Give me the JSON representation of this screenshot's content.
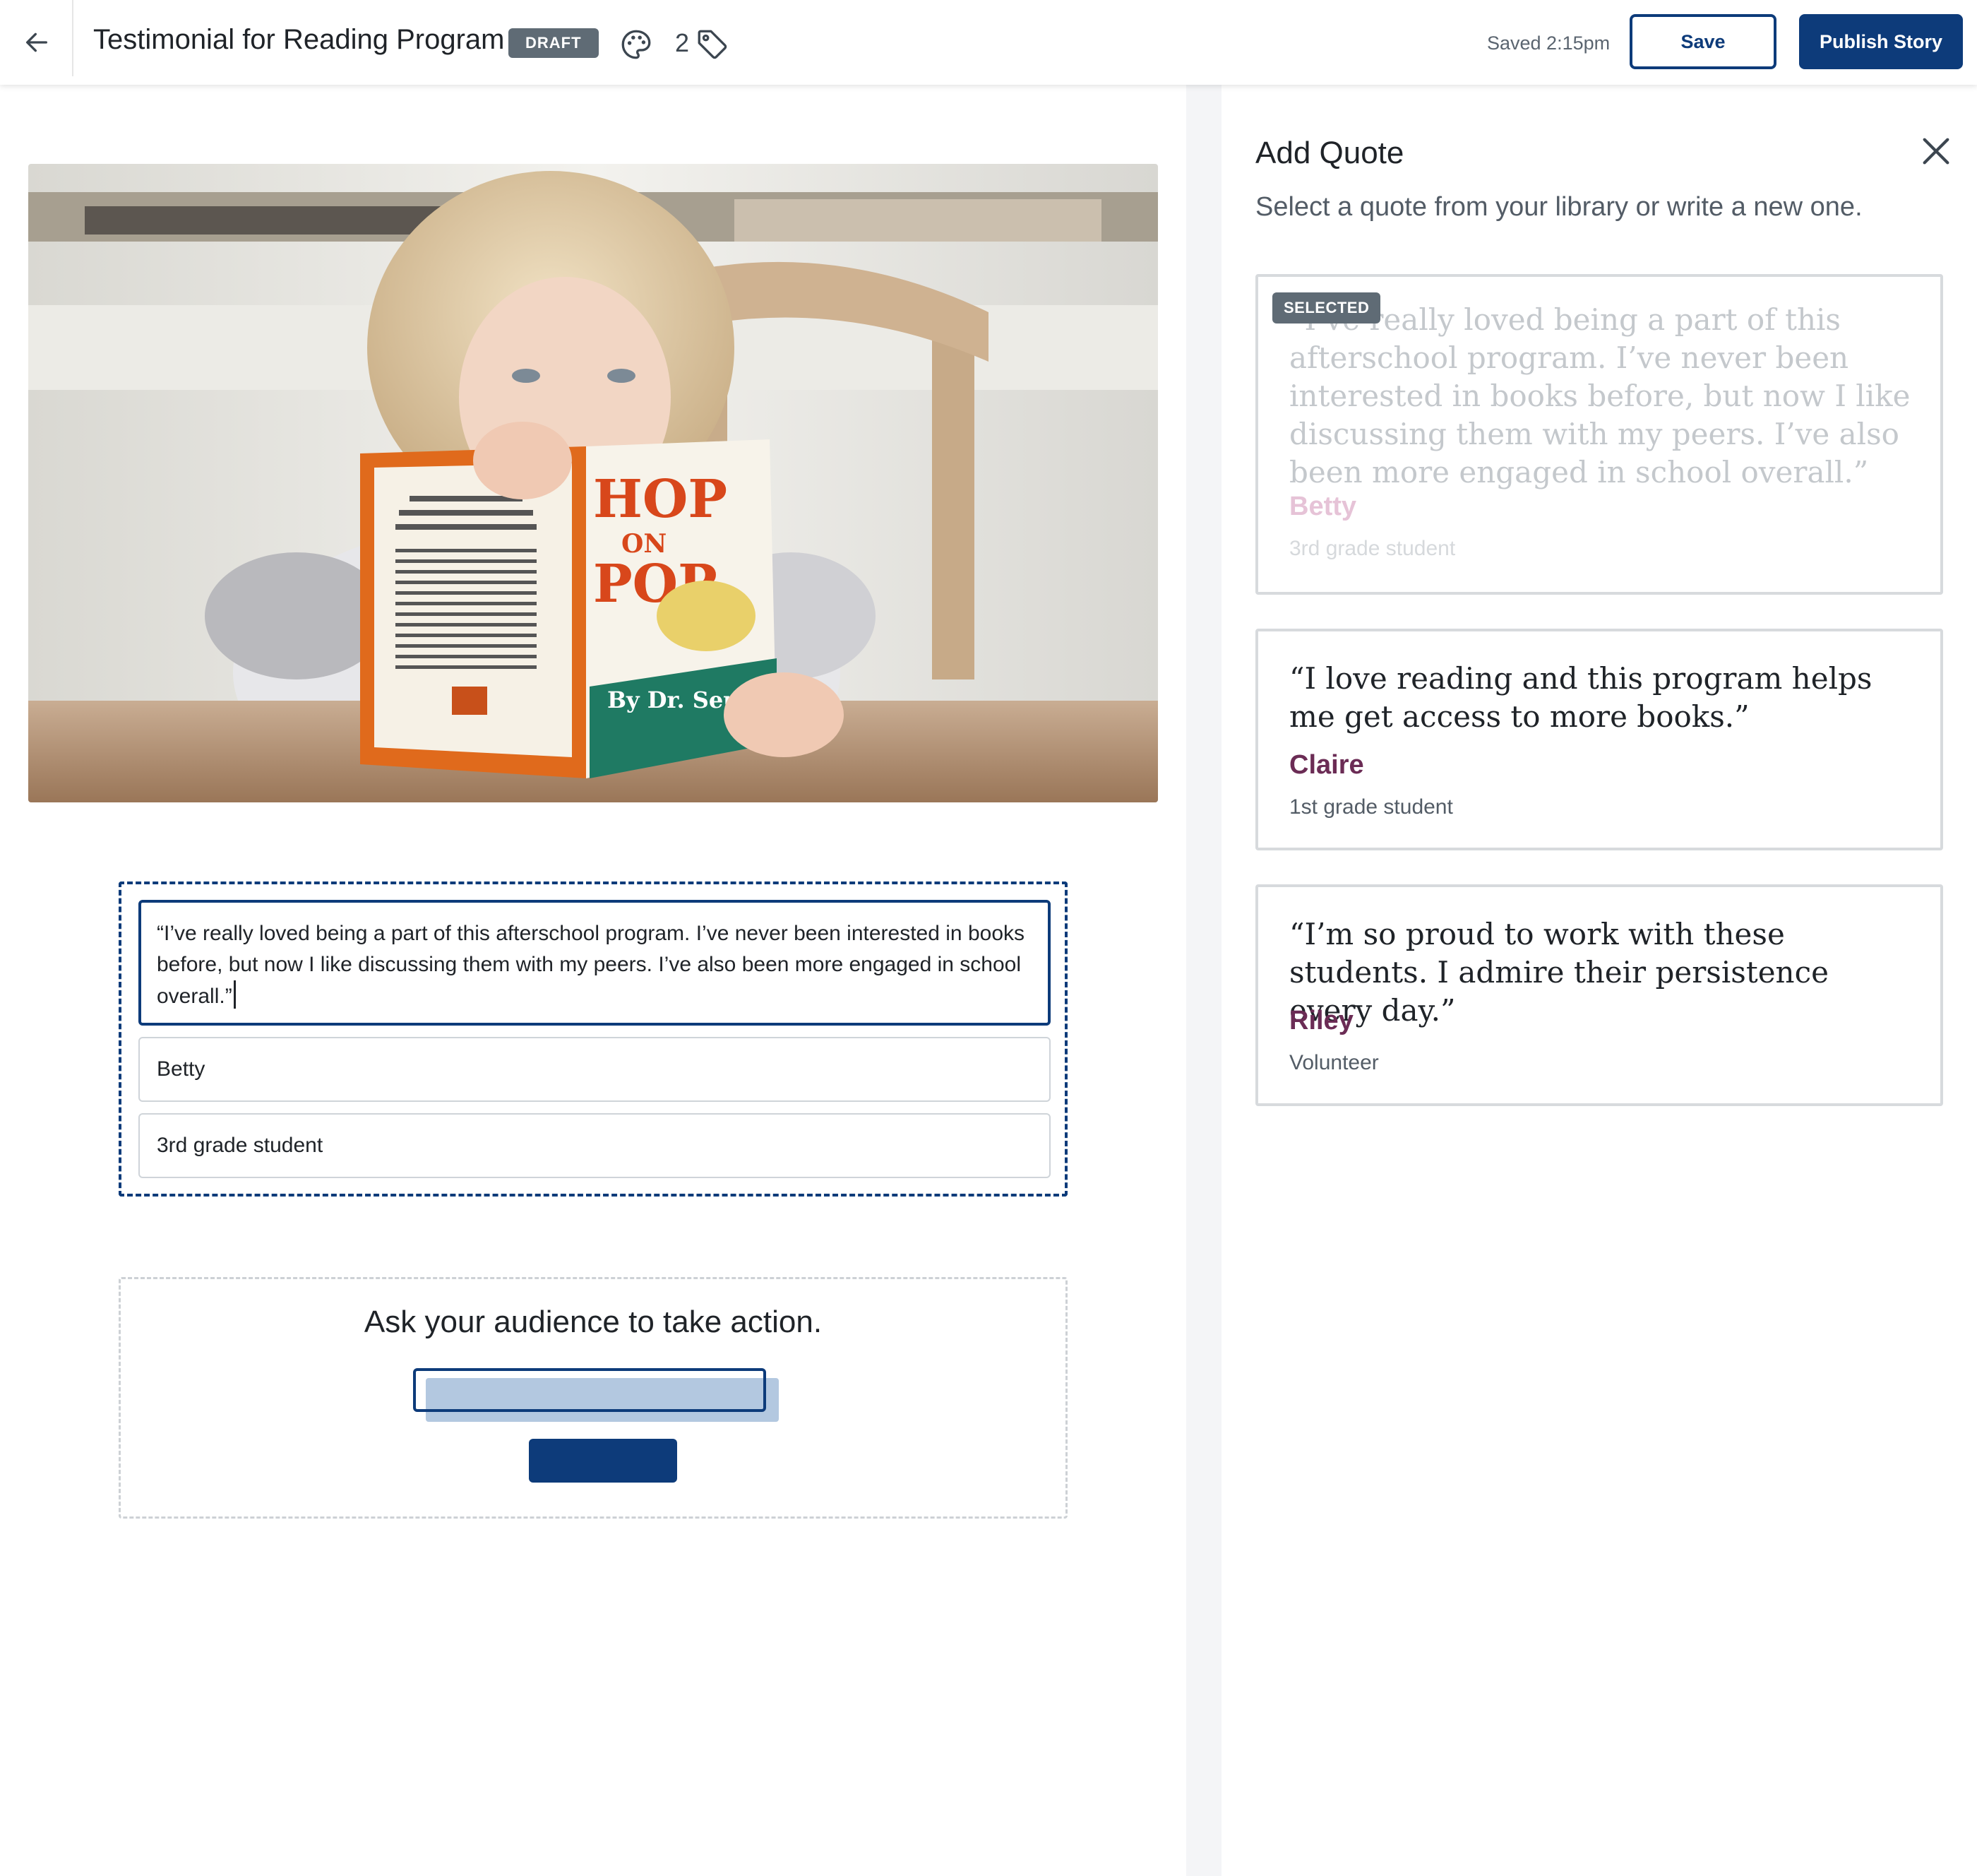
{
  "header": {
    "back_icon": "arrow-left-icon",
    "title": "Testimonial for Reading Program",
    "status_badge": "DRAFT",
    "palette_icon": "palette-icon",
    "tag_count": "2",
    "tag_icon": "tag-icon",
    "saved_status": "Saved 2:15pm",
    "save_label": "Save",
    "publish_label": "Publish Story",
    "accent_color": "#0d3b7a"
  },
  "editor": {
    "hero_image": {
      "book_title_line1": "HOP",
      "book_title_line2": "ON",
      "book_title_line3": "POP",
      "book_author": "By Dr. Seuss"
    },
    "quote_block": {
      "quote_text": "“I’ve really loved being a part of this afterschool program. I’ve never been interested in books before, but now I like discussing them with my peers. I’ve also been more engaged in school overall.”",
      "name_value": "Betty",
      "role_value": "3rd grade student"
    },
    "cta_block": {
      "heading": "Ask your audience to take action."
    }
  },
  "panel": {
    "title": "Add Quote",
    "close_icon": "close-icon",
    "subtitle": "Select a quote from your library or write a new one.",
    "selected_badge": "SELECTED",
    "quotes": [
      {
        "text": "“I’ve really loved being a part of this afterschool program. I’ve never been interested in books before, but now I like discussing them with my peers. I’ve also been more engaged in school overall.”",
        "name": "Betty",
        "role": "3rd grade student",
        "selected": true
      },
      {
        "text": "“I love reading and this program helps me get access to more books.”",
        "name": "Claire",
        "role": "1st grade student",
        "selected": false
      },
      {
        "text": "“I’m so proud to work with these students. I admire their persistence every day.”",
        "name": "Riley",
        "role": "Volunteer",
        "selected": false
      }
    ],
    "name_color": "#6b2c55"
  }
}
